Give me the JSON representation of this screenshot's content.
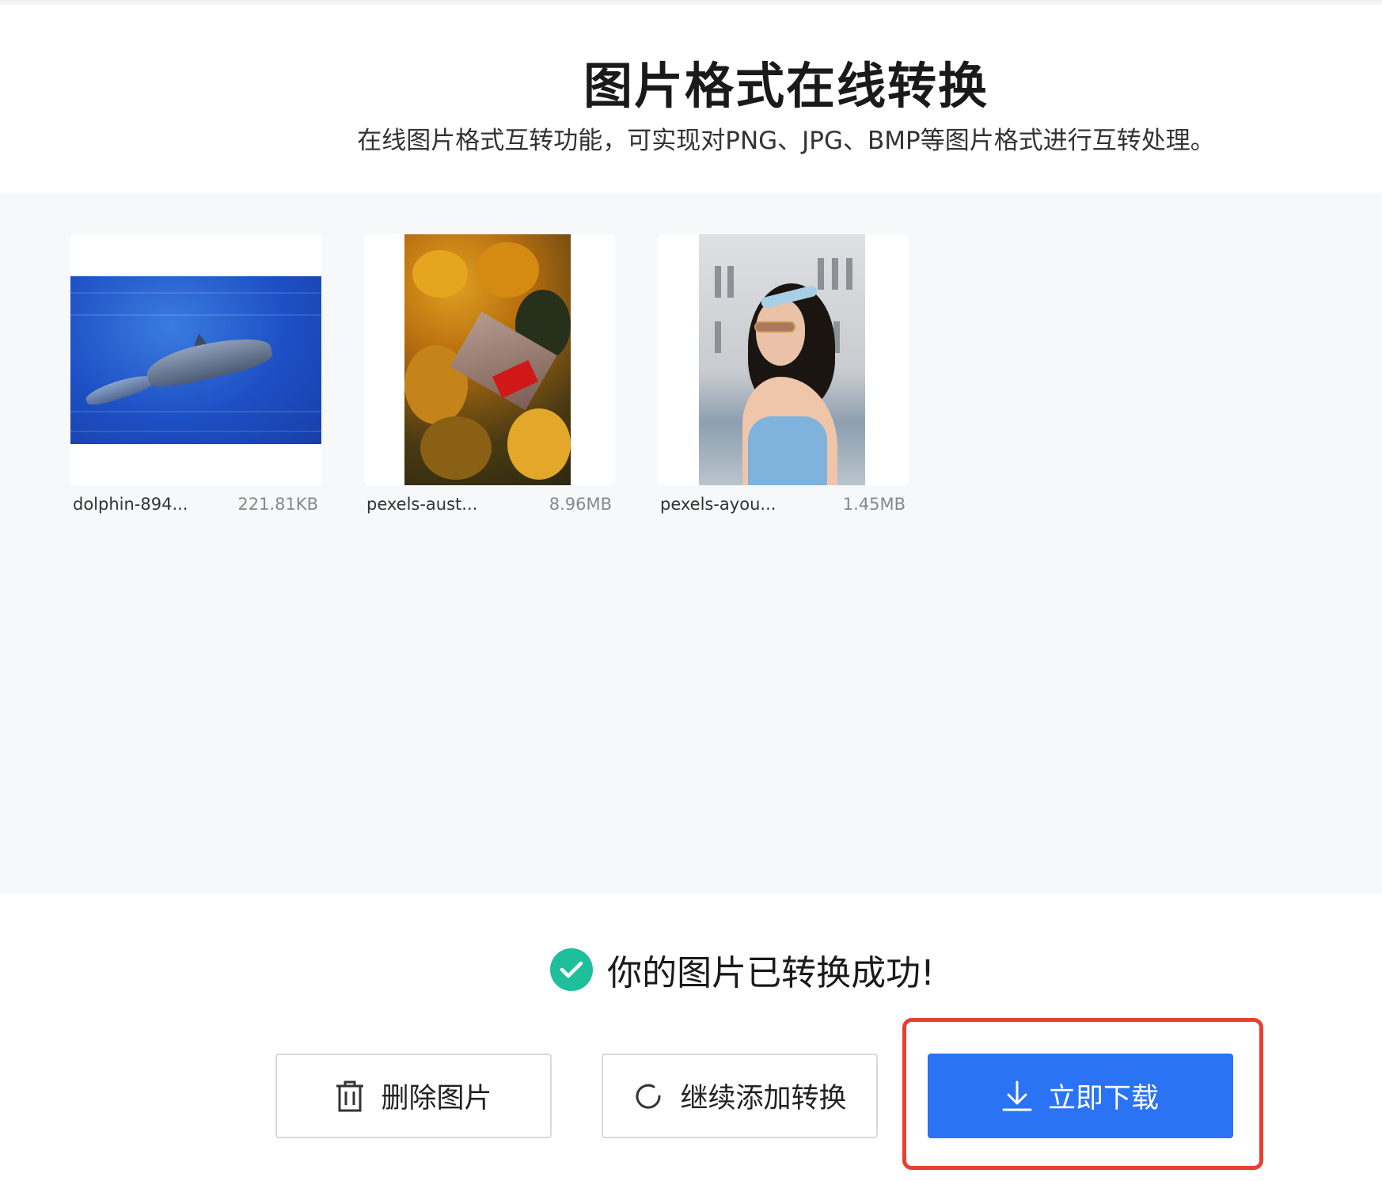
{
  "header": {
    "title": "图片格式在线转换",
    "subtitle": "在线图片格式互转功能，可实现对PNG、JPG、BMP等图片格式进行互转处理。"
  },
  "files": [
    {
      "name": "dolphin-894...",
      "size": "221.81KB",
      "thumbnail_icon": "dolphin-photo"
    },
    {
      "name": "pexels-aust...",
      "size": "8.96MB",
      "thumbnail_icon": "autumn-forest-photo"
    },
    {
      "name": "pexels-ayou...",
      "size": "1.45MB",
      "thumbnail_icon": "woman-portrait-photo"
    }
  ],
  "status": {
    "icon": "check-circle-icon",
    "message": "你的图片已转换成功!"
  },
  "actions": {
    "delete_label": "删除图片",
    "delete_icon": "trash-icon",
    "continue_label": "继续添加转换",
    "continue_icon": "refresh-icon",
    "download_label": "立即下载",
    "download_icon": "download-icon"
  },
  "colors": {
    "primary": "#2a73f5",
    "success": "#1fbf9c",
    "highlight": "#e8402f",
    "gallery_bg": "#f7f8fa"
  }
}
